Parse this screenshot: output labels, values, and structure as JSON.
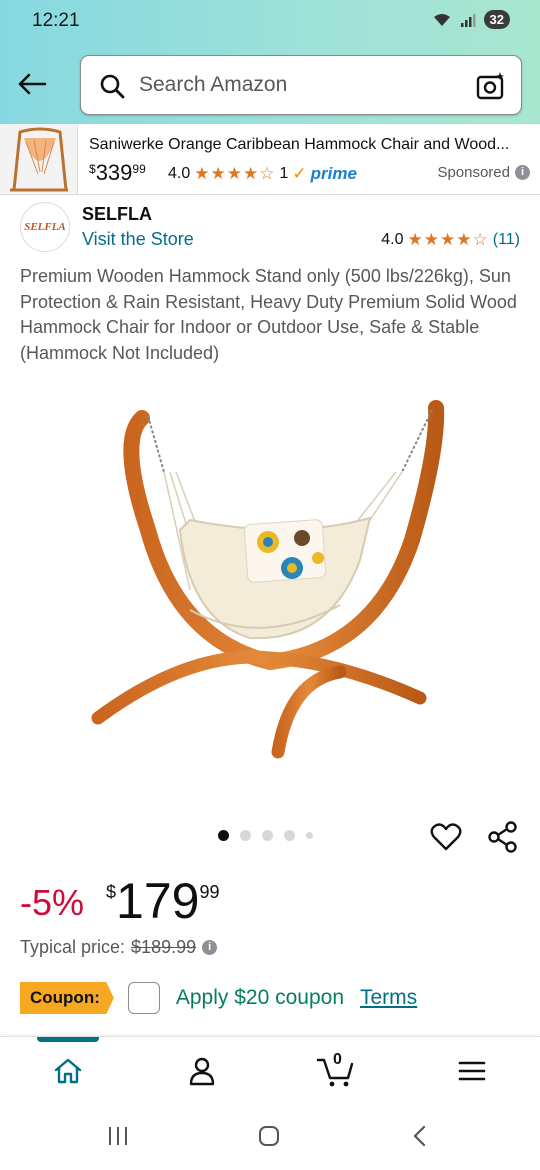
{
  "status_bar": {
    "time": "12:21",
    "battery": "32"
  },
  "search": {
    "placeholder": "Search Amazon"
  },
  "sponsored": {
    "title": "Saniwerke Orange Caribbean Hammock Chair and Wood...",
    "price_symbol": "$",
    "price_whole": "339",
    "price_fraction": "99",
    "rating": "4.0",
    "stars": "★★★★☆",
    "review_count": "1",
    "prime_label": "prime",
    "sponsored_label": "Sponsored"
  },
  "brand": {
    "logo_text": "SELFLA",
    "name": "SELFLA",
    "visit_store": "Visit the Store",
    "rating": "4.0",
    "stars": "★★★★☆",
    "review_count": "(11)"
  },
  "product": {
    "title": "Premium Wooden Hammock Stand only (500 lbs/226kg), Sun Protection & Rain Resistant, Heavy Duty Premium Solid Wood Hammock Chair for Indoor or Outdoor Use, Safe & Stable (Hammock Not Included)"
  },
  "carousel": {
    "dots": 5,
    "active_index": 0
  },
  "pricing": {
    "discount": "-5%",
    "symbol": "$",
    "whole": "179",
    "fraction": "99",
    "typical_label": "Typical price:",
    "typical_value": "$189.99"
  },
  "coupon": {
    "tag": "Coupon:",
    "text": "Apply $20 coupon",
    "terms": "Terms"
  },
  "bottom_nav": {
    "cart_count": "0"
  },
  "colors": {
    "link": "#007185",
    "discount": "#cc0c39",
    "coupon_green": "#067d62",
    "coupon_tag": "#f7a823",
    "star": "#de7921"
  }
}
